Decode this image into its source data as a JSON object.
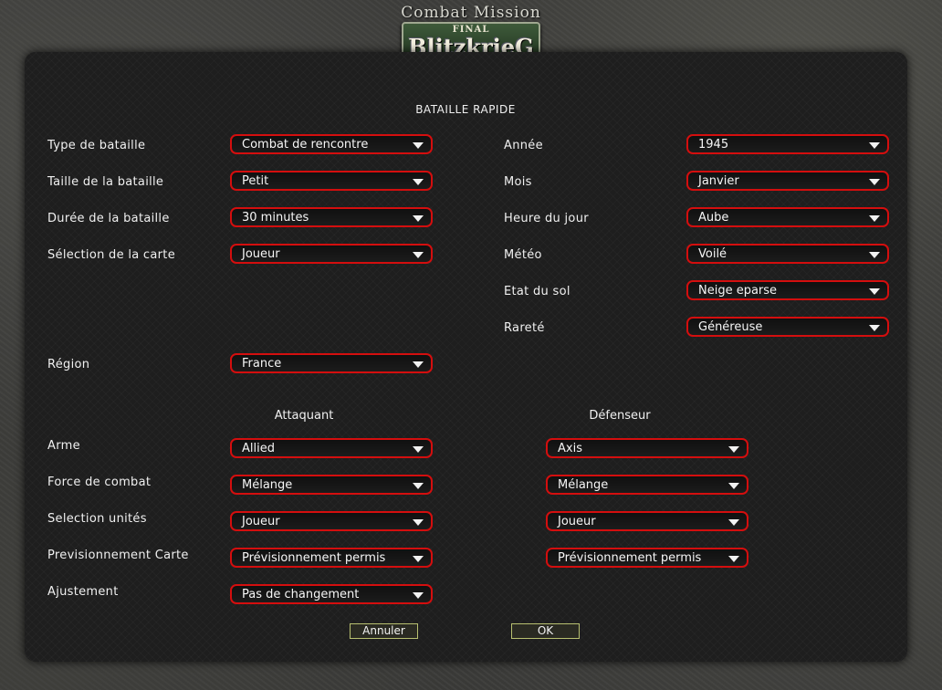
{
  "logo": {
    "top": "Combat Mission",
    "final": "FINAL",
    "main": "BlitzkrieG"
  },
  "title": "BATAILLE RAPIDE",
  "left_fields": [
    {
      "label": "Type de bataille",
      "value": "Combat de rencontre"
    },
    {
      "label": "Taille de la bataille",
      "value": "Petit"
    },
    {
      "label": "Durée de la bataille",
      "value": "30 minutes"
    },
    {
      "label": "Sélection de la carte",
      "value": "Joueur"
    }
  ],
  "right_fields": [
    {
      "label": "Année",
      "value": "1945"
    },
    {
      "label": "Mois",
      "value": "Janvier"
    },
    {
      "label": "Heure du jour",
      "value": "Aube"
    },
    {
      "label": "Météo",
      "value": "Voilé"
    },
    {
      "label": "Etat du sol",
      "value": "Neige eparse"
    },
    {
      "label": "Rareté",
      "value": "Généreuse"
    }
  ],
  "region": {
    "label": "Région",
    "value": "France"
  },
  "columns": {
    "attacker": "Attaquant",
    "defender": "Défenseur"
  },
  "side_rows": [
    {
      "label": "Arme",
      "attacker": "Allied",
      "defender": "Axis"
    },
    {
      "label": "Force de combat",
      "attacker": "Mélange",
      "defender": "Mélange"
    },
    {
      "label": "Selection unités",
      "attacker": "Joueur",
      "defender": "Joueur"
    },
    {
      "label": "Previsionnement Carte",
      "attacker": "Prévisionnement permis",
      "defender": "Prévisionnement permis"
    },
    {
      "label": "Ajustement",
      "attacker": "Pas de changement",
      "defender": null
    }
  ],
  "buttons": {
    "cancel": "Annuler",
    "ok": "OK"
  },
  "colors": {
    "dropdown_border": "#d40e0e",
    "button_border": "#b8c070"
  }
}
